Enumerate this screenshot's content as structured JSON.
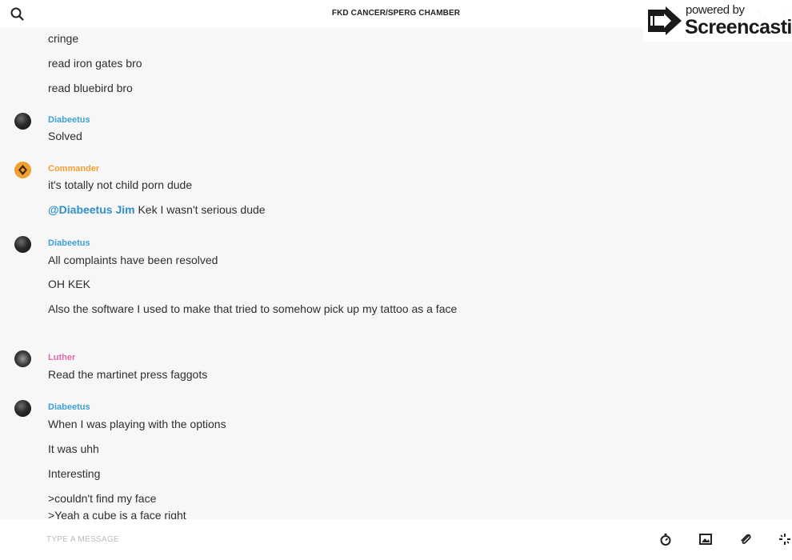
{
  "header": {
    "title": "FKD CANCER/SPERG CHAMBER",
    "icons": [
      "search-icon",
      "phone-icon",
      "info-icon"
    ]
  },
  "watermark": {
    "powered": "powered by",
    "brand": "Screencastify"
  },
  "messages": {
    "g0": {
      "lines": [
        "cringe",
        "read iron gates bro",
        "read bluebird bro"
      ]
    },
    "g1": {
      "sender": "Diabeetus",
      "lines": [
        "Solved"
      ]
    },
    "g2": {
      "sender": "Commander",
      "lines": [
        "it's totally not child porn dude"
      ],
      "mention": "@Diabeetus Jim",
      "mention_rest": " Kek I wasn't serious dude"
    },
    "g3": {
      "sender": "Diabeetus",
      "lines": [
        "All complaints have been resolved",
        "OH KEK",
        "Also the software I used to make that tried to somehow pick up my tattoo as a face"
      ]
    },
    "g4": {
      "sender": "Luther",
      "lines": [
        "Read the martinet press faggots"
      ]
    },
    "g5": {
      "sender": "Diabeetus",
      "lines": [
        "When I was playing with the options",
        "It was uhh",
        "Interesting",
        ">couldn't find my face",
        ">Yeah a cube is a face right"
      ]
    }
  },
  "composer": {
    "placeholder": "TYPE A MESSAGE",
    "icons": [
      "timer-icon",
      "image-icon",
      "attach-icon",
      "sparkle-icon"
    ]
  },
  "colors": {
    "diabeetus": "#3ea0d4",
    "commander": "#f0a030",
    "luther": "#e36bb0",
    "mention": "#2f8fcc"
  }
}
